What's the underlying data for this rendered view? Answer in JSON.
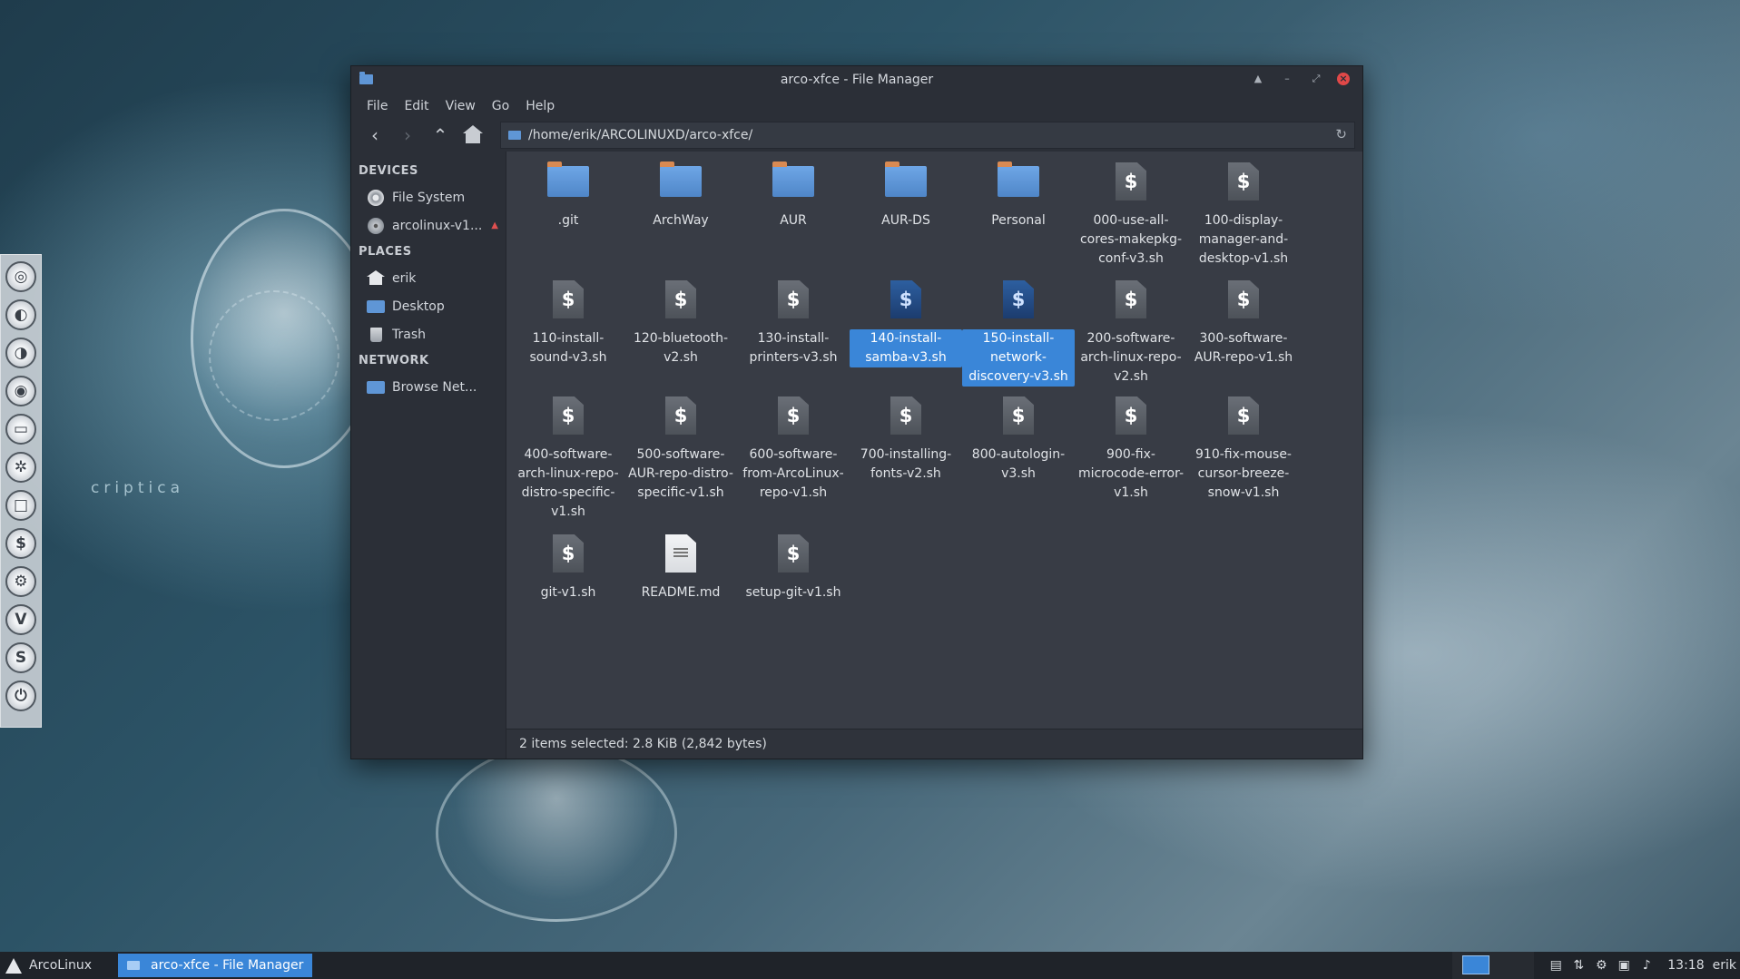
{
  "window": {
    "title": "arco-xfce - File Manager"
  },
  "menubar": [
    "File",
    "Edit",
    "View",
    "Go",
    "Help"
  ],
  "toolbar": {
    "path": "/home/erik/ARCOLINUXD/arco-xfce/"
  },
  "sidebar": {
    "devices_header": "DEVICES",
    "devices": [
      {
        "label": "File System",
        "icon": "disk-icon"
      },
      {
        "label": "arcolinux-v1...",
        "icon": "optical-disc-icon"
      }
    ],
    "places_header": "PLACES",
    "places": [
      {
        "label": "erik",
        "icon": "home-icon"
      },
      {
        "label": "Desktop",
        "icon": "desktop-folder-icon"
      },
      {
        "label": "Trash",
        "icon": "trash-icon"
      }
    ],
    "network_header": "NETWORK",
    "network": [
      {
        "label": "Browse Net...",
        "icon": "network-folder-icon"
      }
    ]
  },
  "files": [
    {
      "name": ".git",
      "type": "folder"
    },
    {
      "name": "ArchWay",
      "type": "folder"
    },
    {
      "name": "AUR",
      "type": "folder"
    },
    {
      "name": "AUR-DS",
      "type": "folder"
    },
    {
      "name": "Personal",
      "type": "folder"
    },
    {
      "name": "000-use-all-cores-makepkg-conf-v3.sh",
      "type": "script"
    },
    {
      "name": "100-display-manager-and-desktop-v1.sh",
      "type": "script"
    },
    {
      "name": "110-install-sound-v3.sh",
      "type": "script"
    },
    {
      "name": "120-bluetooth-v2.sh",
      "type": "script"
    },
    {
      "name": "130-install-printers-v3.sh",
      "type": "script"
    },
    {
      "name": "140-install-samba-v3.sh",
      "type": "script",
      "selected": true
    },
    {
      "name": "150-install-network-discovery-v3.sh",
      "type": "script",
      "selected": true
    },
    {
      "name": "200-software-arch-linux-repo-v2.sh",
      "type": "script"
    },
    {
      "name": "300-software-AUR-repo-v1.sh",
      "type": "script"
    },
    {
      "name": "400-software-arch-linux-repo-distro-specific-v1.sh",
      "type": "script"
    },
    {
      "name": "500-software-AUR-repo-distro-specific-v1.sh",
      "type": "script"
    },
    {
      "name": "600-software-from-ArcoLinux-repo-v1.sh",
      "type": "script"
    },
    {
      "name": "700-installing-fonts-v2.sh",
      "type": "script"
    },
    {
      "name": "800-autologin-v3.sh",
      "type": "script"
    },
    {
      "name": "900-fix-microcode-error-v1.sh",
      "type": "script"
    },
    {
      "name": "910-fix-mouse-cursor-breeze-snow-v1.sh",
      "type": "script"
    },
    {
      "name": "git-v1.sh",
      "type": "script"
    },
    {
      "name": "README.md",
      "type": "document"
    },
    {
      "name": "setup-git-v1.sh",
      "type": "script"
    }
  ],
  "script_glyph": "$",
  "statusbar": {
    "text": "2 items selected: 2.8 KiB (2,842 bytes)"
  },
  "taskbar": {
    "start_label": "ArcoLinux",
    "task_label": "arco-xfce - File Manager",
    "clock": "13:18",
    "user": "erik"
  },
  "wallpaper": {
    "text": "criptica"
  },
  "colors": {
    "selection": "#3a86d8",
    "folder": "#5f96d6",
    "close": "#e04848"
  }
}
